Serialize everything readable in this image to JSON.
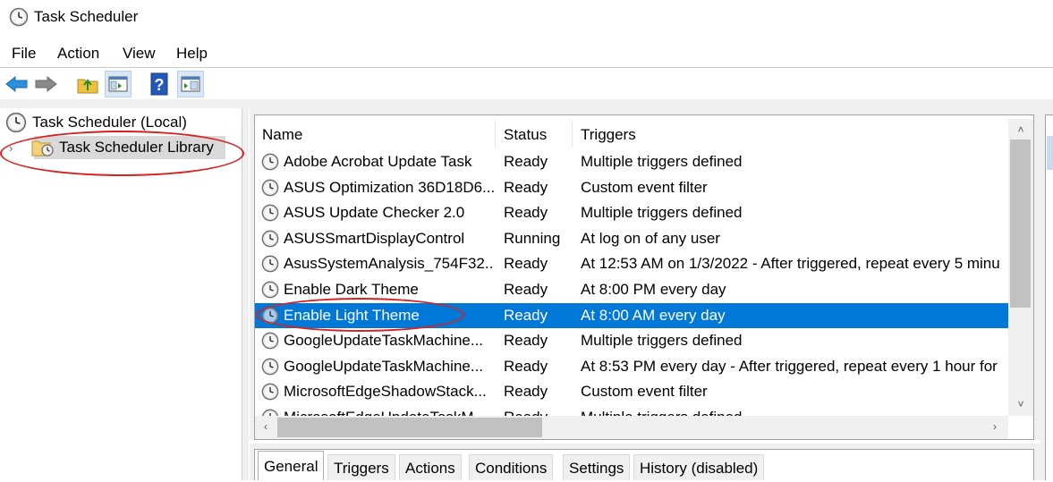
{
  "window": {
    "title": "Task Scheduler",
    "icon": "clock-icon"
  },
  "menu": [
    "File",
    "Action",
    "View",
    "Help"
  ],
  "toolbar": {
    "buttons": [
      "back-arrow-icon",
      "forward-arrow-icon",
      "up-folder-icon",
      "show-hide-console-tree-icon",
      "help-icon",
      "show-hide-action-pane-icon"
    ]
  },
  "tree": {
    "root": "Task Scheduler (Local)",
    "library": "Task Scheduler Library"
  },
  "list": {
    "columns": [
      "Name",
      "Status",
      "Triggers"
    ],
    "rows": [
      {
        "name": "Adobe Acrobat Update Task",
        "status": "Ready",
        "triggers": "Multiple triggers defined"
      },
      {
        "name": "ASUS Optimization 36D18D6...",
        "status": "Ready",
        "triggers": "Custom event filter"
      },
      {
        "name": "ASUS Update Checker 2.0",
        "status": "Ready",
        "triggers": "Multiple triggers defined"
      },
      {
        "name": "ASUSSmartDisplayControl",
        "status": "Running",
        "triggers": "At log on of any user"
      },
      {
        "name": "AsusSystemAnalysis_754F32...",
        "status": "Ready",
        "triggers": "At 12:53 AM on 1/3/2022 - After triggered, repeat every 5 minu"
      },
      {
        "name": "Enable Dark Theme",
        "status": "Ready",
        "triggers": "At 8:00 PM every day"
      },
      {
        "name": "Enable Light Theme",
        "status": "Ready",
        "triggers": "At 8:00 AM every day",
        "selected": true
      },
      {
        "name": "GoogleUpdateTaskMachine...",
        "status": "Ready",
        "triggers": "Multiple triggers defined"
      },
      {
        "name": "GoogleUpdateTaskMachine...",
        "status": "Ready",
        "triggers": "At 8:53 PM every day - After triggered, repeat every 1 hour for"
      },
      {
        "name": "MicrosoftEdgeShadowStack...",
        "status": "Ready",
        "triggers": "Custom event filter"
      },
      {
        "name": "MicrosoftEdgeUpdateTaskM...",
        "status": "Ready",
        "triggers": "Multiple triggers defined"
      }
    ]
  },
  "tabs": [
    "General",
    "Triggers",
    "Actions",
    "Conditions",
    "Settings",
    "History (disabled)"
  ],
  "active_tab": "General",
  "colors": {
    "selection": "#0078d7",
    "annotation": "#d92020",
    "tree_highlight": "#d9d9d9"
  }
}
